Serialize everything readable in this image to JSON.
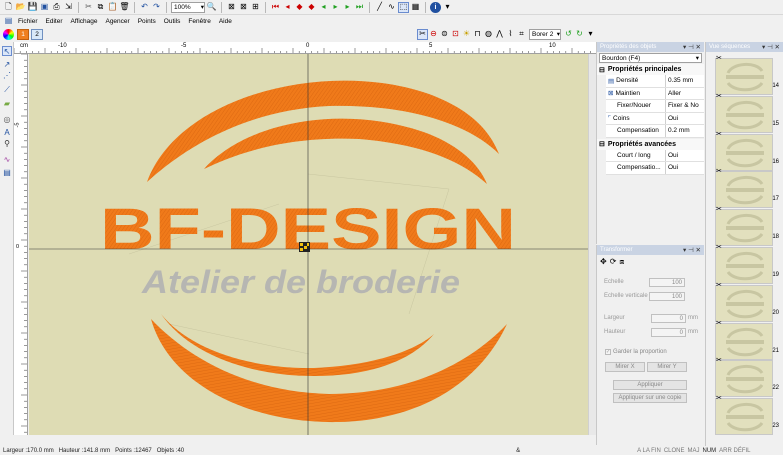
{
  "toolbar": {
    "zoom_value": "100%",
    "icons": [
      "new-icon",
      "open-icon",
      "save-icon",
      "print-icon",
      "cut-icon",
      "copy-icon",
      "paste-icon",
      "undo-icon",
      "redo-icon",
      "zoom-fit-icon",
      "zoom-icon",
      "help-icon"
    ]
  },
  "menu": [
    "Fichier",
    "Editer",
    "Affichage",
    "Agencer",
    "Points",
    "Outils",
    "Fenêtre",
    "Aide"
  ],
  "toolbar2": {
    "tab1": "1",
    "tab2": "2",
    "stitch_type": "Borer 2"
  },
  "ruler": {
    "unit": "cm",
    "h_labels": [
      "-10",
      "-5",
      "0",
      "5",
      "10"
    ],
    "v_labels": [
      "-5",
      "0"
    ]
  },
  "canvas": {
    "logo_title": "BF-DESIGN",
    "logo_subtitle": "Atelier de broderie",
    "colors": {
      "background": "#dedcb4",
      "orange": "#f07a1a",
      "gray_text": "#b8b8b8"
    }
  },
  "properties_panel": {
    "title": "Propriétés des objets",
    "object": "Bourdon (F4)",
    "group_main": "Propriétés principales",
    "main_rows": [
      {
        "key": "Densité",
        "value": "0.35 mm"
      },
      {
        "key": "Maintien",
        "value": "Aller"
      },
      {
        "key": "Fixer/Nouer",
        "value": "Fixer & No"
      },
      {
        "key": "Coins",
        "value": "Oui"
      },
      {
        "key": "Compensation",
        "value": "0.2 mm"
      }
    ],
    "group_adv": "Propriétés avancées",
    "adv_rows": [
      {
        "key": "Court / long",
        "value": "Oui"
      },
      {
        "key": "Compensatio...",
        "value": "Oui"
      }
    ]
  },
  "transform_panel": {
    "title": "Transformer",
    "echelle_label": "Echelle",
    "echelle_value": "100",
    "echelle_v_label": "Echelle verticale",
    "echelle_v_value": "100",
    "largeur_label": "Largeur",
    "largeur_value": "0",
    "hauteur_label": "Hauteur",
    "hauteur_value": "0",
    "unit": "mm",
    "keep_ratio_label": "Garder la proportion",
    "mirror_x": "Mirer X",
    "mirror_y": "Mirer Y",
    "apply": "Appliquer",
    "apply_copy": "Appliquer sur une copie"
  },
  "sequence_panel": {
    "title": "Vue séquences",
    "item_numbers": [
      "14",
      "15",
      "16",
      "17",
      "18",
      "19",
      "20",
      "21",
      "22",
      "23"
    ]
  },
  "status": {
    "width": "Largeur :170.0 mm",
    "height": "Hauteur :141.8 mm",
    "points": "Points :12467",
    "objects": "Objets :40",
    "amp": "&",
    "a_la_fin": "A LA FIN",
    "clone": "CLONE",
    "maj": "MAJ",
    "num": "NUM",
    "arr_defil": "ARR DÉFIL"
  }
}
